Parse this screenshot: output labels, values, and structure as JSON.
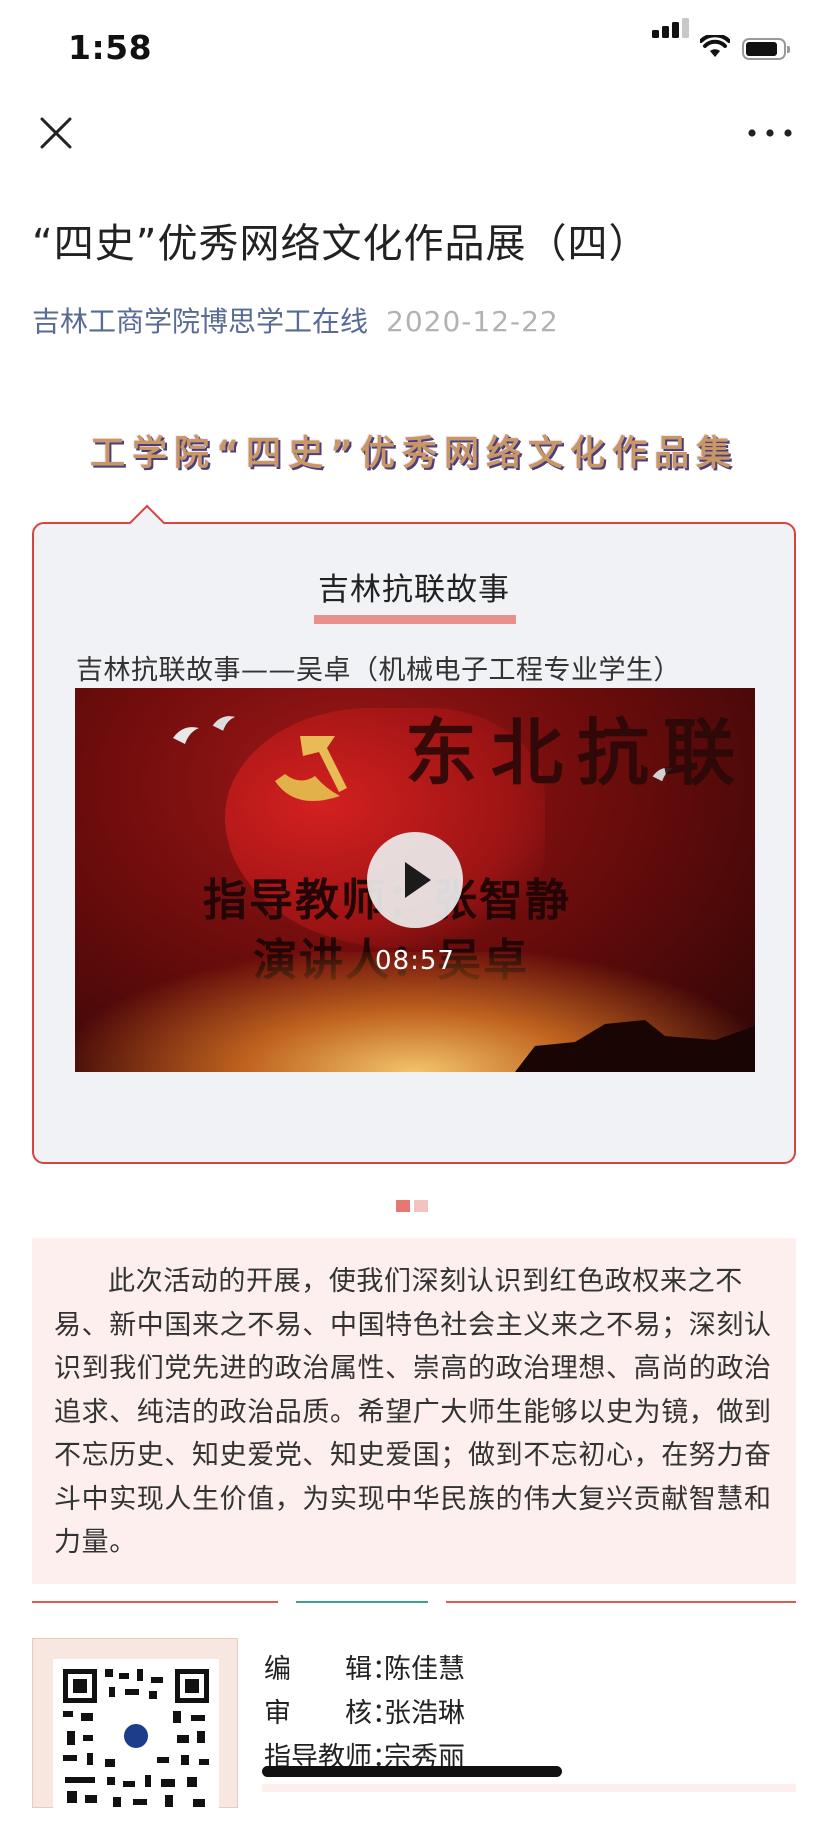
{
  "status_bar": {
    "time": "1:58",
    "battery_level": 0.85
  },
  "nav": {
    "close_icon": "close-icon",
    "more_icon": "more-icon"
  },
  "article": {
    "title": "“四史”优秀网络文化作品展（四）",
    "author": "吉林工商学院博思学工在线",
    "date": "2020-12-22"
  },
  "collection": {
    "title": "工学院“四史”优秀网络文化作品集",
    "title_color": "#c89766"
  },
  "card": {
    "heading": "吉林抗联故事",
    "caption": "吉林抗联故事——吴卓（机械电子工程专业学生）",
    "accent": "#d9433e",
    "video": {
      "headline": "东北抗联",
      "line1": "指导教师：张智静",
      "line2": "演讲人：吴卓",
      "duration": "08:57",
      "play_icon": "play-icon"
    }
  },
  "pager": {
    "total": 2,
    "active": 0
  },
  "paragraph": "此次活动的开展，使我们深刻认识到红色政权来之不易、新中国来之不易、中国特色社会主义来之不易；深刻认识到我们党先进的政治属性、崇高的政治理想、高尚的政治追求、纯洁的政治品质。希望广大师生能够以史为镜，做到不忘历史、知史爱党、知史爱国；做到不忘初心，在努力奋斗中实现人生价值，为实现中华民族的伟大复兴贡献智慧和力量。",
  "dividers": {
    "left": "#e05a54",
    "middle": "#3fa08f",
    "right": "#e05a54"
  },
  "credits": [
    {
      "label": "编　　辑：",
      "value": "陈佳慧"
    },
    {
      "label": "审　　核：",
      "value": "张浩琳"
    },
    {
      "label": "指导教师：",
      "value": "宗秀丽"
    }
  ],
  "qr_code": "qr-code-image"
}
